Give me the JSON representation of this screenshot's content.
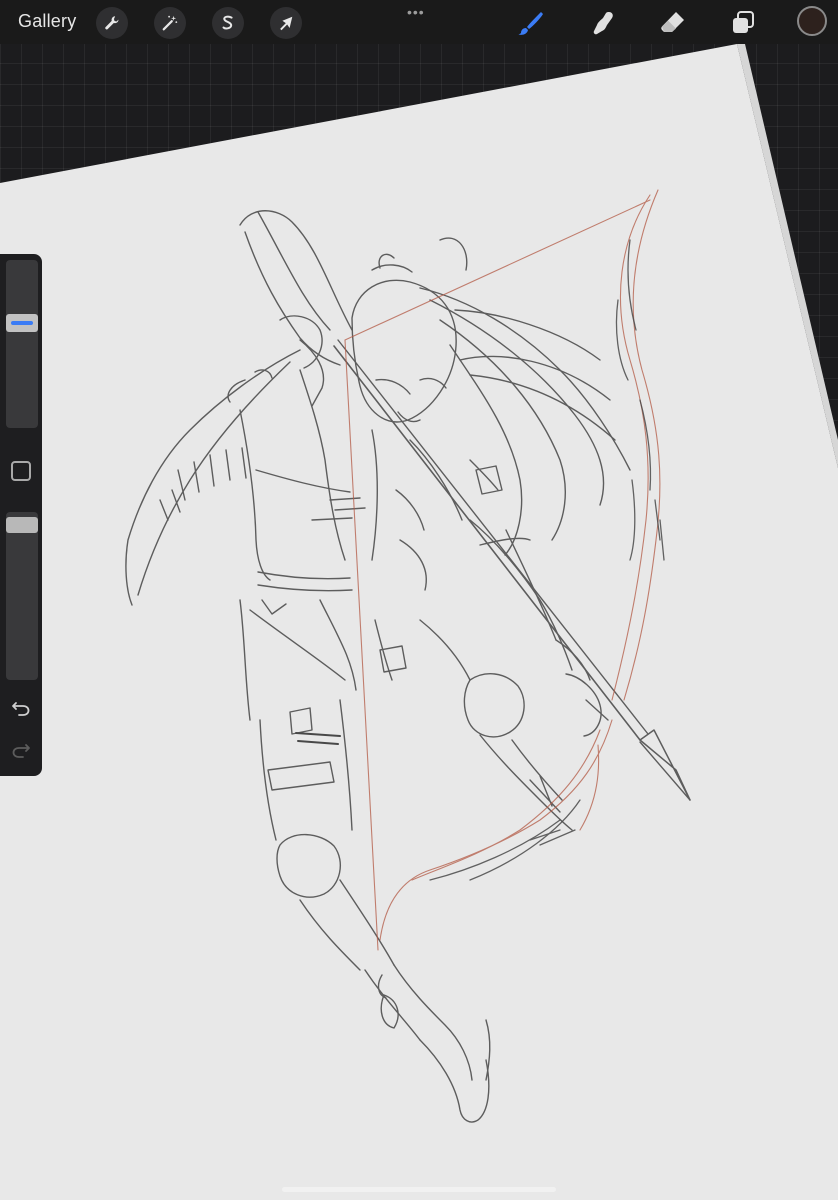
{
  "toolbar": {
    "gallery_label": "Gallery",
    "left_tools": [
      {
        "name": "actions",
        "icon": "wrench-icon"
      },
      {
        "name": "adjustments",
        "icon": "magic-wand-icon"
      },
      {
        "name": "selection",
        "icon": "selection-s-icon"
      },
      {
        "name": "transform",
        "icon": "arrow-cursor-icon"
      }
    ],
    "more_label": "•••",
    "right_tools": [
      {
        "name": "brush",
        "icon": "brush-icon",
        "active": true
      },
      {
        "name": "smudge",
        "icon": "smudge-finger-icon",
        "active": false
      },
      {
        "name": "eraser",
        "icon": "eraser-icon",
        "active": false
      },
      {
        "name": "layers",
        "icon": "layers-icon",
        "active": false
      }
    ],
    "current_color": "#2d211d"
  },
  "sidebar": {
    "brush_size_level": 0.64,
    "opacity_level": 0.97,
    "modify_button": "square-modify-icon",
    "undo_icon": "undo-arrow-icon",
    "redo_icon": "redo-arrow-icon"
  },
  "theme": {
    "accent": "#3b7cf5",
    "toolbar_bg": "#1a1a1a",
    "paper": "#e9e9e9",
    "sketch_dark": "#4a4a4a",
    "sketch_red": "#b35a45"
  }
}
